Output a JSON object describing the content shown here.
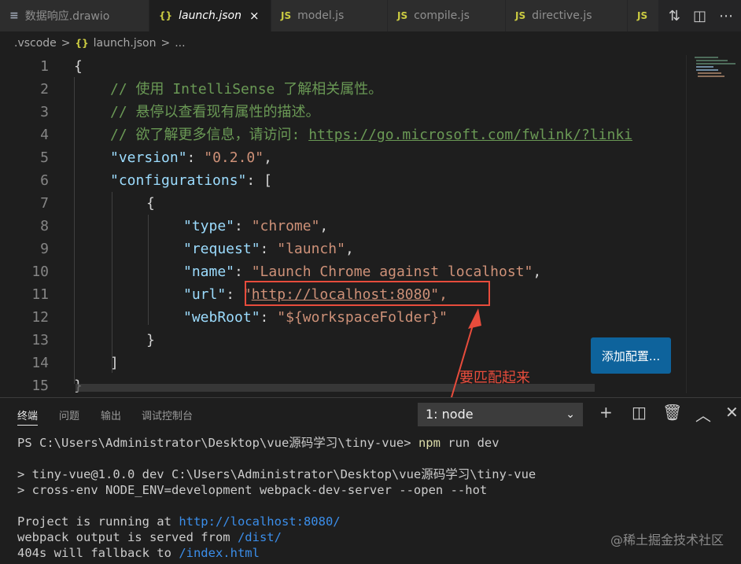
{
  "tabs": [
    {
      "icon": "≡",
      "label": "数据响应.drawio"
    },
    {
      "icon": "{}",
      "label": "launch.json",
      "close": "×"
    },
    {
      "icon": "JS",
      "label": "model.js"
    },
    {
      "icon": "JS",
      "label": "compile.js"
    },
    {
      "icon": "JS",
      "label": "directive.js"
    },
    {
      "icon": "JS",
      "label": ""
    }
  ],
  "breadcrumb": {
    "folder": ".vscode",
    "sep": ">",
    "file_icon": "{}",
    "file": "launch.json",
    "more": "..."
  },
  "editor": {
    "line_numbers": [
      "1",
      "2",
      "3",
      "4",
      "5",
      "6",
      "7",
      "8",
      "9",
      "10",
      "11",
      "12",
      "13",
      "14",
      "15"
    ],
    "lines": {
      "l1": "{",
      "l2": "// 使用 IntelliSense 了解相关属性。",
      "l3": "// 悬停以查看现有属性的描述。",
      "l4_comment": "// 欲了解更多信息，请访问: ",
      "l4_link": "https://go.microsoft.com/fwlink/?linki",
      "l5_key": "\"version\"",
      "l5_val": "\"0.2.0\"",
      "l6_key": "\"configurations\"",
      "l6_rest": ": [",
      "l7": "{",
      "l8_key": "\"type\"",
      "l8_val": "\"chrome\"",
      "l9_key": "\"request\"",
      "l9_val": "\"launch\"",
      "l10_key": "\"name\"",
      "l10_val": "\"Launch Chrome against localhost\"",
      "l11_key": "\"url\"",
      "l11_q": "\"",
      "l11_link": "http://localhost:8080",
      "l11_end": "\",",
      "l12_key": "\"webRoot\"",
      "l12_val": "\"${workspaceFolder}\"",
      "l13": "}",
      "l14": "]",
      "l15": "}"
    },
    "add_config_label": "添加配置..."
  },
  "annotation": {
    "text": "要匹配起来"
  },
  "panel": {
    "tabs": [
      "终端",
      "问题",
      "输出",
      "调试控制台"
    ],
    "terminal_select": "1: node",
    "terminal_lines": {
      "t1_prompt": "PS C:\\Users\\Administrator\\Desktop\\vue源码学习\\tiny-vue> ",
      "t1_cmd": "npm",
      "t1_args": " run dev",
      "t2": "> tiny-vue@1.0.0 dev C:\\Users\\Administrator\\Desktop\\vue源码学习\\tiny-vue",
      "t3": "> cross-env NODE_ENV=development webpack-dev-server --open --hot",
      "t4_text": "Project is running at ",
      "t4_link": "http://localhost:8080/",
      "t5_text": "webpack output is served from ",
      "t5_link": "/dist/",
      "t6_text": "404s will fallback to ",
      "t6_link": "/index.html"
    }
  },
  "watermark": "@稀土掘金技术社区"
}
